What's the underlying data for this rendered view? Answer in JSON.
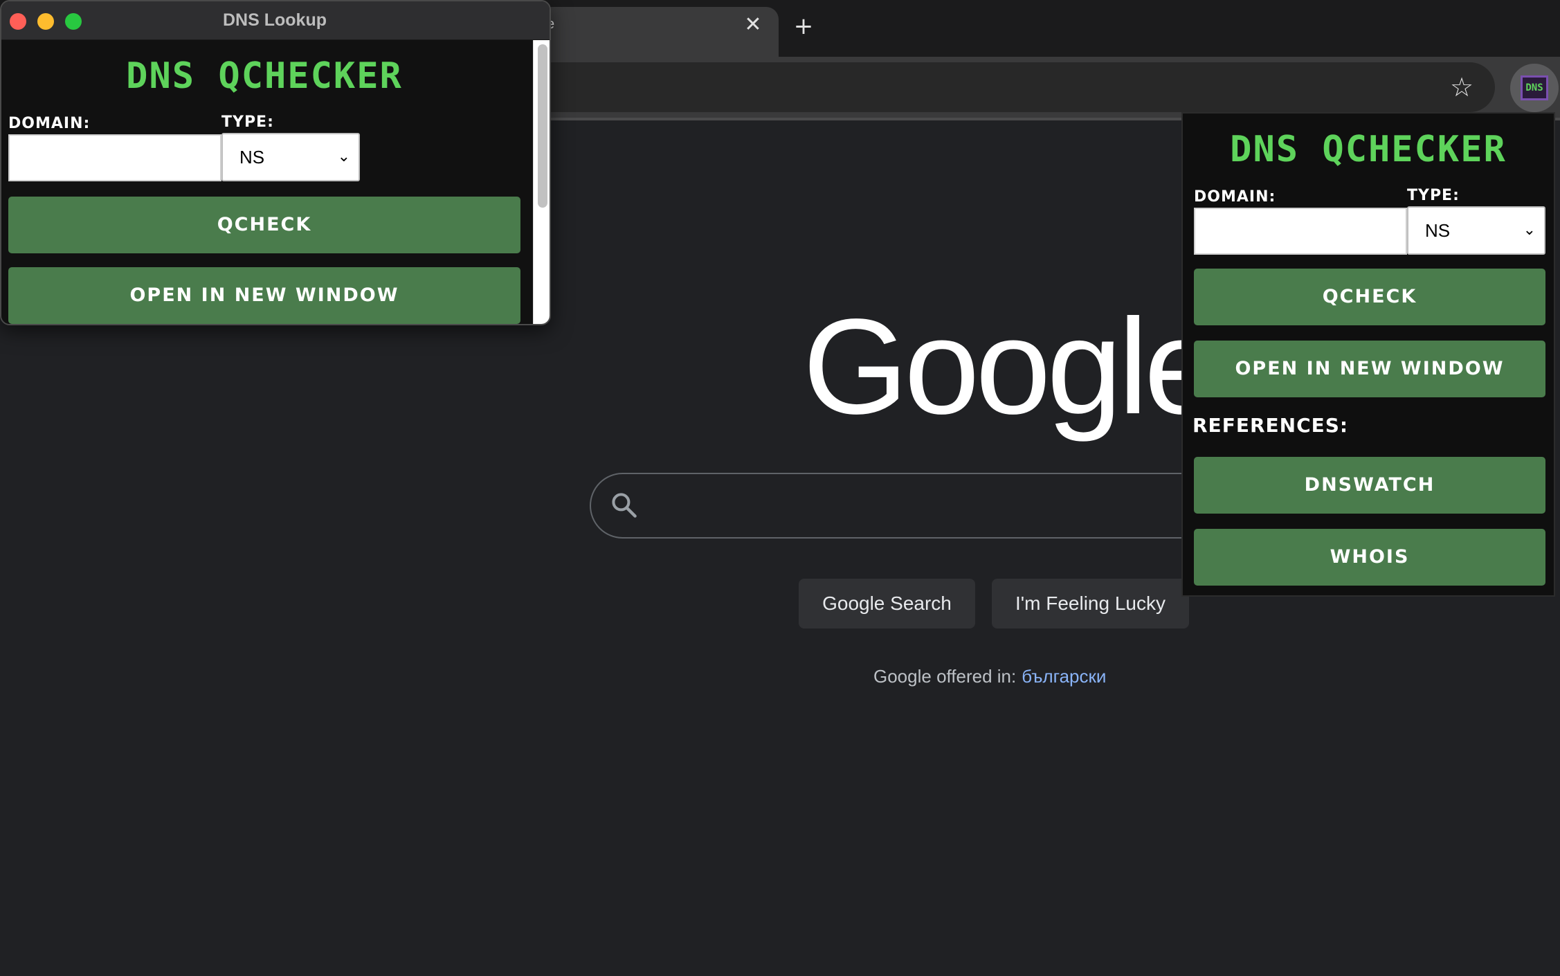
{
  "browser": {
    "tab_title_fragment": "e",
    "tab_close_glyph": "✕",
    "new_tab_glyph": "+",
    "bookmark_star_glyph": "☆",
    "extension_badge": "DNS"
  },
  "google": {
    "logo": "Google",
    "search_button": "Google Search",
    "lucky_button": "I'm Feeling Lucky",
    "offered_in_label": "Google offered in:",
    "offered_language": "български"
  },
  "window": {
    "title": "DNS Lookup"
  },
  "app": {
    "title": "DNS QCHECKER",
    "domain_label": "Domain:",
    "domain_value": "",
    "type_label": "Type:",
    "type_value": "NS",
    "check_button": "QCheck",
    "open_window_button": "Open in new window",
    "references_label": "References:",
    "reference_buttons": [
      "DNSWatch",
      "WHOIS"
    ]
  },
  "colors": {
    "accent_green": "#5ed35b",
    "button_green": "#4a7c4c",
    "panel_bg": "#0f0f0f",
    "page_bg": "#202124",
    "link_blue": "#8ab4f8"
  }
}
